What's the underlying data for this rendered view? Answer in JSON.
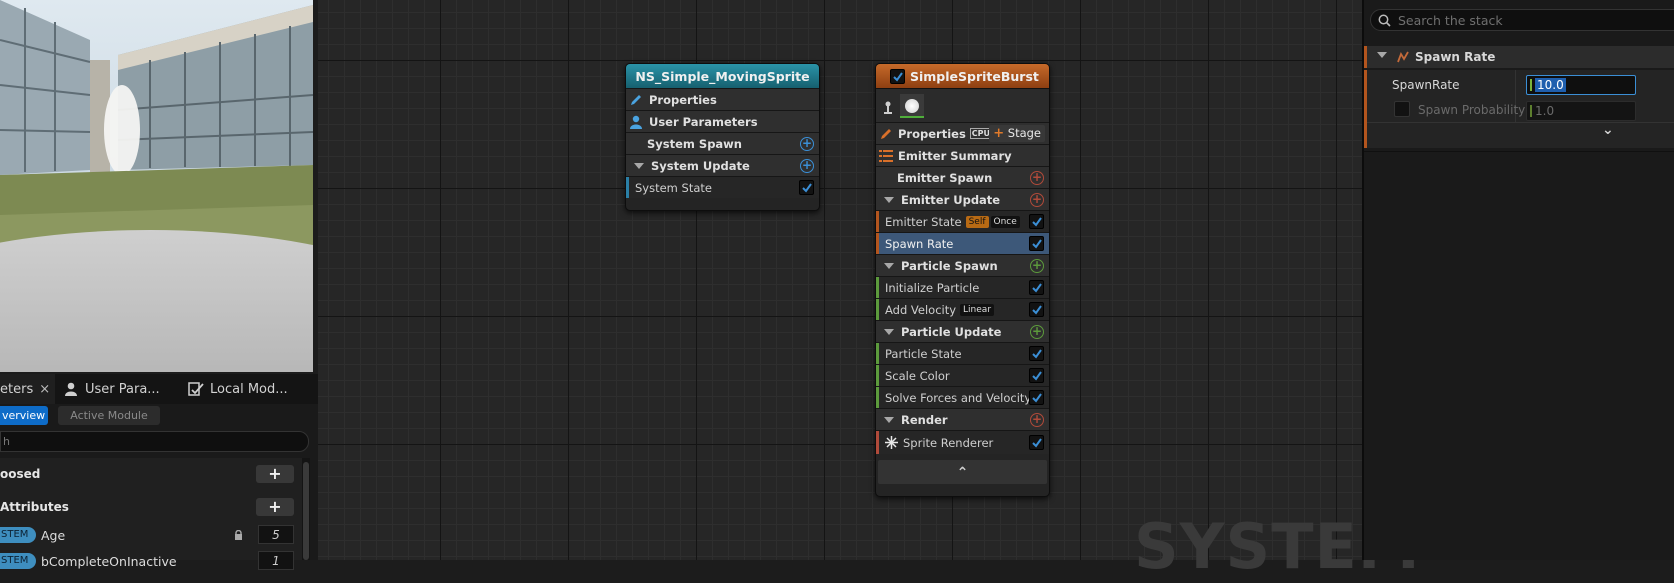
{
  "params_panel": {
    "tabs": [
      {
        "label": "eters",
        "close": "×"
      },
      {
        "label": "User Para..."
      },
      {
        "label": "Local Mod..."
      }
    ],
    "filter_buttons": {
      "overview": "verview",
      "active_module": "Active Module"
    },
    "search_value": "h",
    "sections": [
      {
        "label": "oosed",
        "add": "+"
      },
      {
        "label": "Attributes",
        "add": "+"
      }
    ],
    "rows": [
      {
        "badge": "STEM",
        "name": "Age",
        "value": "5"
      },
      {
        "badge": "STEM",
        "name": "bCompleteOnInactive",
        "value": "1"
      }
    ]
  },
  "system_node": {
    "title": "NS_Simple_MovingSprite",
    "rows": [
      {
        "label": "Properties",
        "icon": "pencil-icon"
      },
      {
        "label": "User Parameters",
        "icon": "user-icon"
      },
      {
        "label": "System Spawn",
        "action": "add"
      },
      {
        "label": "System Update",
        "action": "add",
        "collapsible": true
      },
      {
        "label": "System State",
        "enabled": true
      }
    ]
  },
  "emitter_node": {
    "title": "SimpleSpriteBurst",
    "properties_label": "Properties",
    "cpu_badge": "CPU",
    "stage_button": "Stage",
    "summary_label": "Emitter Summary",
    "emitter_spawn": "Emitter Spawn",
    "emitter_update": "Emitter Update",
    "emitter_state": "Emitter State",
    "emitter_state_tags": [
      "Self",
      "Once"
    ],
    "spawn_rate": "Spawn Rate",
    "particle_spawn": "Particle Spawn",
    "initialize_particle": "Initialize Particle",
    "add_velocity": "Add Velocity",
    "add_velocity_tag": "Linear",
    "particle_update": "Particle Update",
    "particle_state": "Particle State",
    "scale_color": "Scale Color",
    "solve_forces": "Solve Forces and Velocity",
    "render": "Render",
    "sprite_renderer": "Sprite Renderer",
    "collapse_glyph": "⌃"
  },
  "details_panel": {
    "search_placeholder": "Search the stack",
    "section_title": "Spawn Rate",
    "spawnrate_label": "SpawnRate",
    "spawnrate_value": "10.0",
    "probability_label": "Spawn Probability",
    "probability_value": "1.0",
    "expand_glyph": "⌄"
  },
  "watermark": "SYSTEM",
  "colors": {
    "system_header": "#1e7f94",
    "emitter_header": "#b3551e",
    "selection": "#3d5879",
    "accent_blue": "#3b8fd6",
    "stage_plus": "#e07a2a"
  }
}
